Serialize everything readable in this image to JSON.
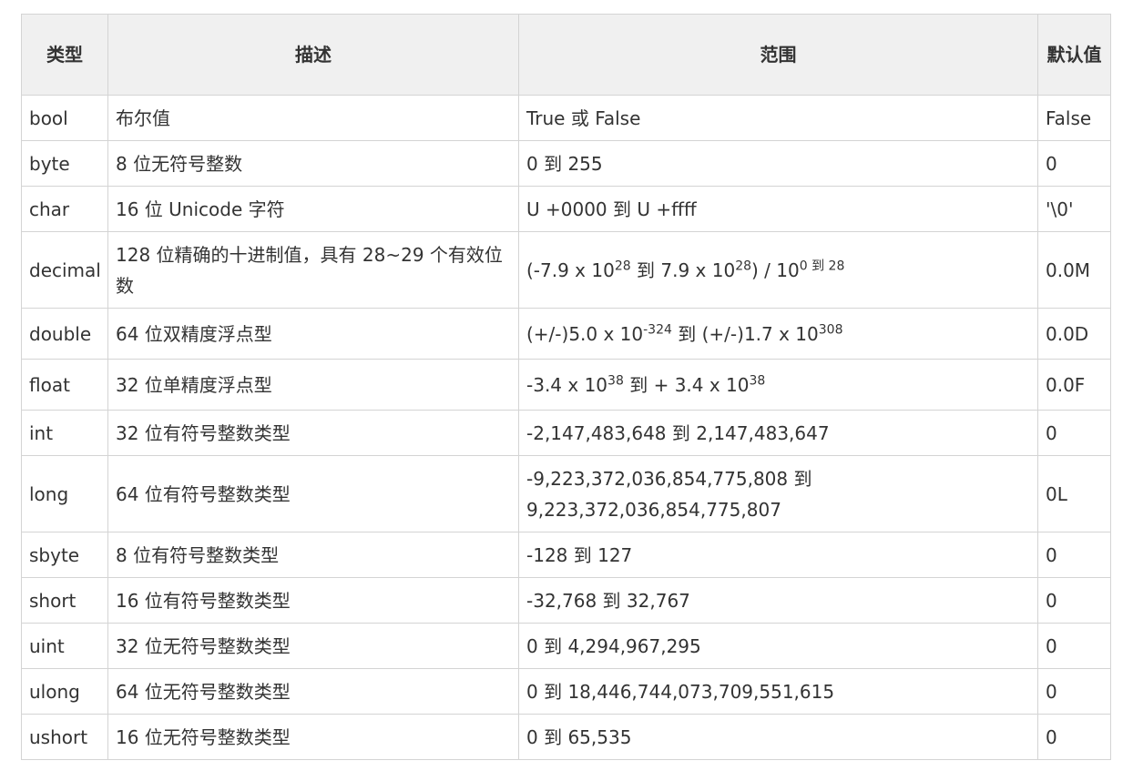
{
  "table": {
    "headers": [
      "类型",
      "描述",
      "范围",
      "默认值"
    ],
    "rows": [
      {
        "type": "bool",
        "desc": "布尔值",
        "range": "True 或 False",
        "default": "False"
      },
      {
        "type": "byte",
        "desc": "8 位无符号整数",
        "range": "0 到 255",
        "default": "0"
      },
      {
        "type": "char",
        "desc": "16 位 Unicode 字符",
        "range": "U +0000 到 U +ffff",
        "default": "'\\0'"
      },
      {
        "type": "decimal",
        "desc": "128 位精确的十进制值，具有 28~29 个有效位数",
        "range": [
          "(-7.9 x 10",
          "28",
          " 到 7.9 x 10",
          "28",
          ") / 10",
          "0 到 28"
        ],
        "default": "0.0M"
      },
      {
        "type": "double",
        "desc": "64 位双精度浮点型",
        "range": [
          "(+/-)5.0 x 10",
          "-324",
          " 到 (+/-)1.7 x 10",
          "308"
        ],
        "default": "0.0D"
      },
      {
        "type": "float",
        "desc": "32 位单精度浮点型",
        "range": [
          "-3.4 x 10",
          "38",
          " 到 + 3.4 x 10",
          "38"
        ],
        "default": "0.0F"
      },
      {
        "type": "int",
        "desc": "32 位有符号整数类型",
        "range": "-2,147,483,648 到 2,147,483,647",
        "default": "0"
      },
      {
        "type": "long",
        "desc": "64 位有符号整数类型",
        "range": "-9,223,372,036,854,775,808 到 9,223,372,036,854,775,807",
        "default": "0L"
      },
      {
        "type": "sbyte",
        "desc": "8 位有符号整数类型",
        "range": "-128 到 127",
        "default": "0"
      },
      {
        "type": "short",
        "desc": "16 位有符号整数类型",
        "range": "-32,768 到 32,767",
        "default": "0"
      },
      {
        "type": "uint",
        "desc": "32 位无符号整数类型",
        "range": "0 到 4,294,967,295",
        "default": "0"
      },
      {
        "type": "ulong",
        "desc": "64 位无符号整数类型",
        "range": "0 到 18,446,744,073,709,551,615",
        "default": "0"
      },
      {
        "type": "ushort",
        "desc": "16 位无符号整数类型",
        "range": "0 到 65,535",
        "default": "0"
      }
    ]
  }
}
